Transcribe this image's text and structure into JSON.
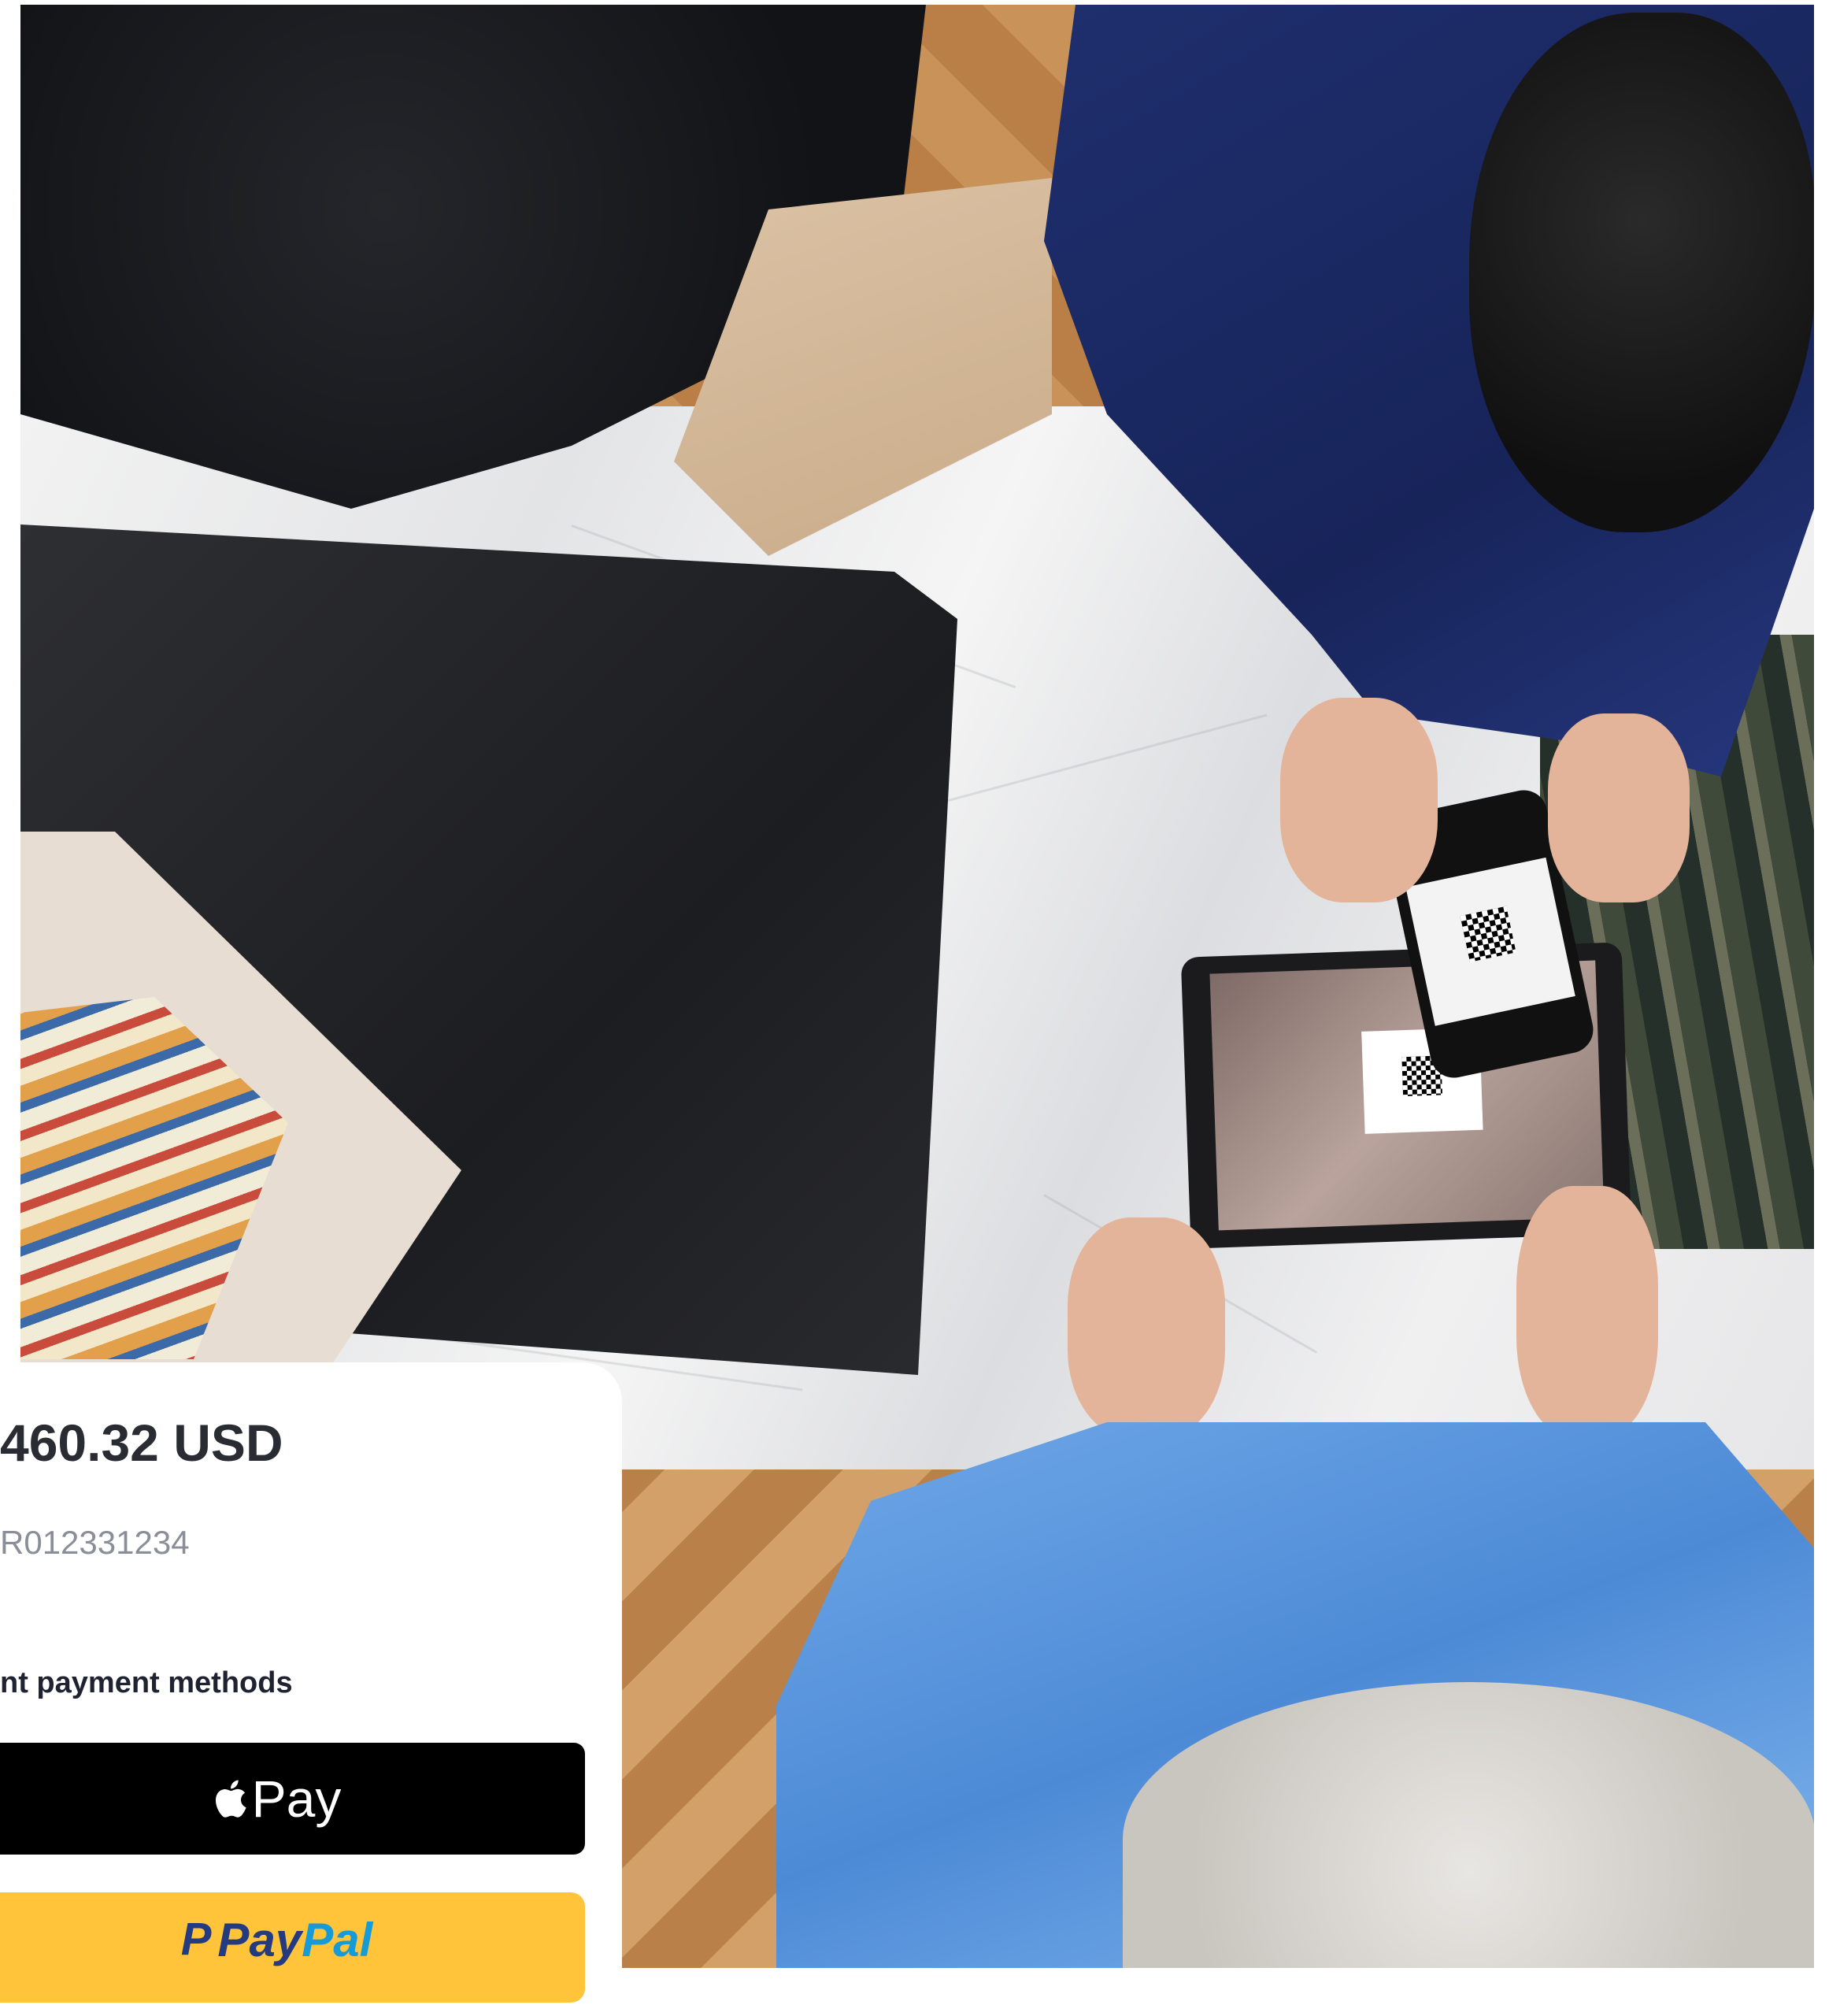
{
  "payment": {
    "amount": "460.32 USD",
    "reference": "R012331234",
    "methods_label": "nt payment methods",
    "apple_pay": {
      "icon": "apple-icon",
      "label": "Pay"
    },
    "paypal": {
      "mark": "P",
      "label_part1": "Pay",
      "label_part2": "Pal"
    }
  },
  "colors": {
    "apple_pay_bg": "#000000",
    "paypal_bg": "#ffc43a",
    "paypal_dark": "#253b80",
    "paypal_light": "#179bd7",
    "amount_text": "#2a2c34"
  }
}
